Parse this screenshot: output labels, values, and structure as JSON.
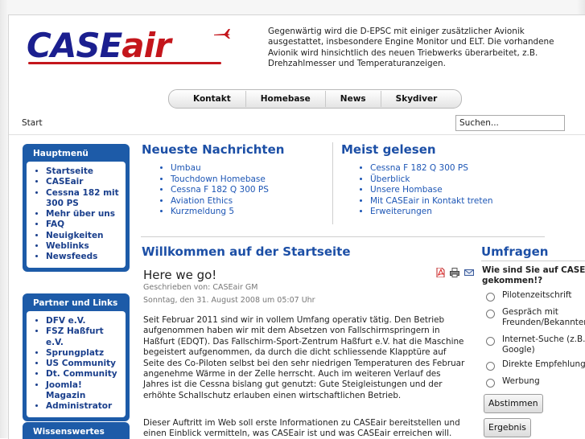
{
  "site": {
    "logo_text_case": "CASE",
    "logo_text_air": "air",
    "intro": "Gegenwärtig wird die D-EPSC mit einiger zusätzlicher Avionik ausgestattet, insbesondere Engine Monitor und ELT. Die vorhandene Avionik wird hinsichtlich des neuen Triebwerks überarbeitet, z.B. Drehzahlmesser und Temperaturanzeigen.",
    "colors": {
      "brand_blue": "#1b1f8f",
      "brand_red": "#c4161c",
      "module_blue": "#1d5ba8",
      "link_blue": "#1d56b5"
    }
  },
  "nav": {
    "items": [
      "Kontakt",
      "Homebase",
      "News",
      "Skydiver"
    ]
  },
  "breadcrumb": "Start",
  "search": {
    "placeholder": "Suchen..."
  },
  "sidebar": {
    "main_menu": {
      "title": "Hauptmenü",
      "items": [
        "Startseite",
        "CASEair",
        "Cessna 182 mit 300 PS",
        "Mehr über uns",
        "FAQ",
        "Neuigkeiten",
        "Weblinks",
        "Newsfeeds"
      ]
    },
    "partners": {
      "title": "Partner und Links",
      "items": [
        "DFV e.V.",
        "FSZ Haßfurt e.V.",
        "Sprungplatz",
        "US Community",
        "Dt. Community",
        "Joomla! Magazin",
        "Administrator"
      ]
    },
    "info": {
      "title": "Wissenswertes"
    }
  },
  "latest_news": {
    "title": "Neueste Nachrichten",
    "items": [
      "Umbau",
      "Touchdown Homebase",
      "Cessna F 182 Q 300 PS",
      "Aviation Ethics",
      "Kurzmeldung 5"
    ]
  },
  "most_read": {
    "title": "Meist gelesen",
    "items": [
      "Cessna F 182 Q 300 PS",
      "Überblick",
      "Unsere Hombase",
      "Mit CASEair in Kontakt treten",
      "Erweiterungen"
    ]
  },
  "main": {
    "welcome_title": "Willkommen auf der Startseite",
    "article": {
      "title": "Here we go!",
      "author": "Geschrieben von: CASEair GM",
      "date": "Sonntag, den 31. August 2008 um 05:07 Uhr",
      "paragraph1": "Seit Februar 2011 sind wir in vollem Umfang operativ tätig. Den Betrieb aufgenommen haben wir mit dem Absetzen von Fallschirmspringern in Haßfurt (EDQT). Das Fallschirm-Sport-Zentrum Haßfurt e.V. hat die Maschine begeistert aufgenommen, da durch die dicht schliessende Klapptüre auf Seite des Co-Piloten selbst bei den sehr niedrigen Temperaturen des Februar angenehme Wärme in der Zelle herrscht. Auch im weiteren Verlauf des Jahres ist die Cessna bislang gut genutzt: Gute Steigleistungen und der erhöhte Schallschutz erlauben einen wirtschaftlichen Betrieb.",
      "paragraph2": "Dieser Auftritt im Web soll erste Informationen zu CASEair bereitstellen und einen Einblick vermitteln, was CASEair ist und was CASEair erreichen will. Sicherlich gibt"
    }
  },
  "poll": {
    "title": "Umfragen",
    "question_line1": "Wie sind Sie auf CASEair",
    "question_line2": "gekommen!?",
    "options": [
      {
        "line1": "Pilotenzeitschrift",
        "line2": ""
      },
      {
        "line1": "Gespräch mit",
        "line2": "Freunden/Bekannten"
      },
      {
        "line1": "Internet-Suche (z.B.",
        "line2": "Google)"
      },
      {
        "line1": "Direkte Empfehlung",
        "line2": ""
      },
      {
        "line1": "Werbung",
        "line2": ""
      }
    ],
    "vote_label": "Abstimmen",
    "results_label": "Ergebnis"
  }
}
